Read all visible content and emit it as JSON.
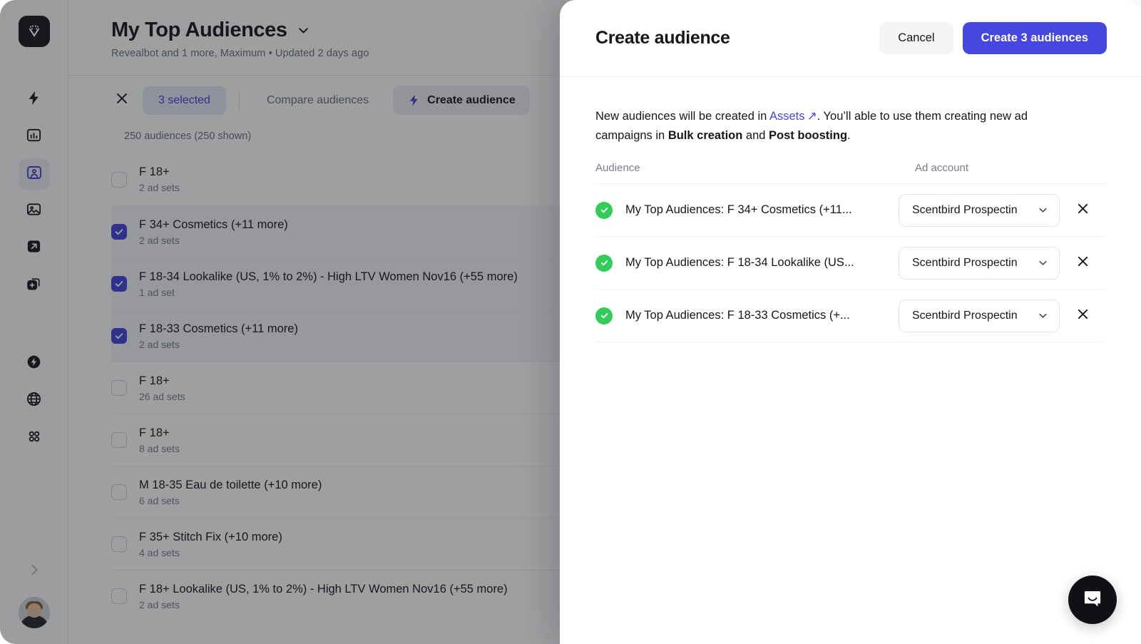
{
  "sidebar": {
    "logo_icon": "revealbot-logo-icon",
    "items": [
      {
        "icon": "bolt-icon",
        "name": "automation"
      },
      {
        "icon": "bar-chart-icon",
        "name": "reports"
      },
      {
        "icon": "audience-person-icon",
        "name": "audiences",
        "active": true
      },
      {
        "icon": "image-icon",
        "name": "creatives"
      },
      {
        "icon": "arrow-up-right-box-icon",
        "name": "launch"
      },
      {
        "icon": "copy-plus-icon",
        "name": "bulk-creation"
      },
      {
        "icon": "bolt-circle-icon",
        "name": "rules"
      },
      {
        "icon": "globe-icon",
        "name": "network"
      },
      {
        "icon": "grid-apps-icon",
        "name": "apps"
      }
    ],
    "collapse_icon": "chevron-right-icon",
    "avatar": "user-avatar"
  },
  "page": {
    "title": "My Top Audiences",
    "title_caret_icon": "chevron-down-icon",
    "subtitle": "Revealbot and 1 more, Maximum • Updated 2 days ago",
    "count_line": "250 audiences (250 shown)"
  },
  "toolbar": {
    "clear_icon": "close-x-icon",
    "selected_pill": "3 selected",
    "compare_label": "Compare audiences",
    "create_label": "Create audience",
    "create_icon": "bolt-icon"
  },
  "audience_list": [
    {
      "name": "F 18+",
      "ad_sets": "2 ad sets",
      "checked": false
    },
    {
      "name": "F 34+ Cosmetics (+11 more)",
      "ad_sets": "2 ad sets",
      "checked": true
    },
    {
      "name": "F 18-34 Lookalike (US, 1% to 2%) - High LTV Women Nov16 (+55 more)",
      "ad_sets": "1 ad set",
      "checked": true
    },
    {
      "name": "F 18-33 Cosmetics (+11 more)",
      "ad_sets": "2 ad sets",
      "checked": true
    },
    {
      "name": "F 18+",
      "ad_sets": "26 ad sets",
      "checked": false
    },
    {
      "name": "F 18+",
      "ad_sets": "8 ad sets",
      "checked": false
    },
    {
      "name": "M 18-35 Eau de toilette (+10 more)",
      "ad_sets": "6 ad sets",
      "checked": false
    },
    {
      "name": "F 35+ Stitch Fix (+10 more)",
      "ad_sets": "4 ad sets",
      "checked": false
    },
    {
      "name": "F 18+ Lookalike (US, 1% to 2%) - High LTV Women Nov16 (+55 more)",
      "ad_sets": "2 ad sets",
      "checked": false
    }
  ],
  "modal": {
    "title": "Create audience",
    "cancel_label": "Cancel",
    "primary_label": "Create 3 audiences",
    "intro": {
      "part1": "New audiences will be created in ",
      "link": "Assets",
      "link_icon": "external-link-icon",
      "part2": ". You’ll able to use them creating new ad campaigns in ",
      "bold1": "Bulk creation",
      "part3": " and ",
      "bold2": "Post boosting",
      "part4": "."
    },
    "col_audience": "Audience",
    "col_ad_account": "Ad account",
    "rows": [
      {
        "status_icon": "check-circle-icon",
        "name": "My Top Audiences: F 34+ Cosmetics (+11...",
        "account": "Scentbird Prospectin",
        "caret_icon": "chevron-down-icon",
        "remove_icon": "close-x-icon"
      },
      {
        "status_icon": "check-circle-icon",
        "name": "My Top Audiences: F 18-34 Lookalike (US...",
        "account": "Scentbird Prospectin",
        "caret_icon": "chevron-down-icon",
        "remove_icon": "close-x-icon"
      },
      {
        "status_icon": "check-circle-icon",
        "name": "My Top Audiences: F 18-33 Cosmetics (+...",
        "account": "Scentbird Prospectin",
        "caret_icon": "chevron-down-icon",
        "remove_icon": "close-x-icon"
      }
    ]
  },
  "chat": {
    "icon": "intercom-chat-icon"
  },
  "colors": {
    "accent": "#4646e0",
    "accent_soft": "#e5e7f7",
    "success": "#33cc5b",
    "text": "#15171a",
    "muted": "#787d85"
  }
}
